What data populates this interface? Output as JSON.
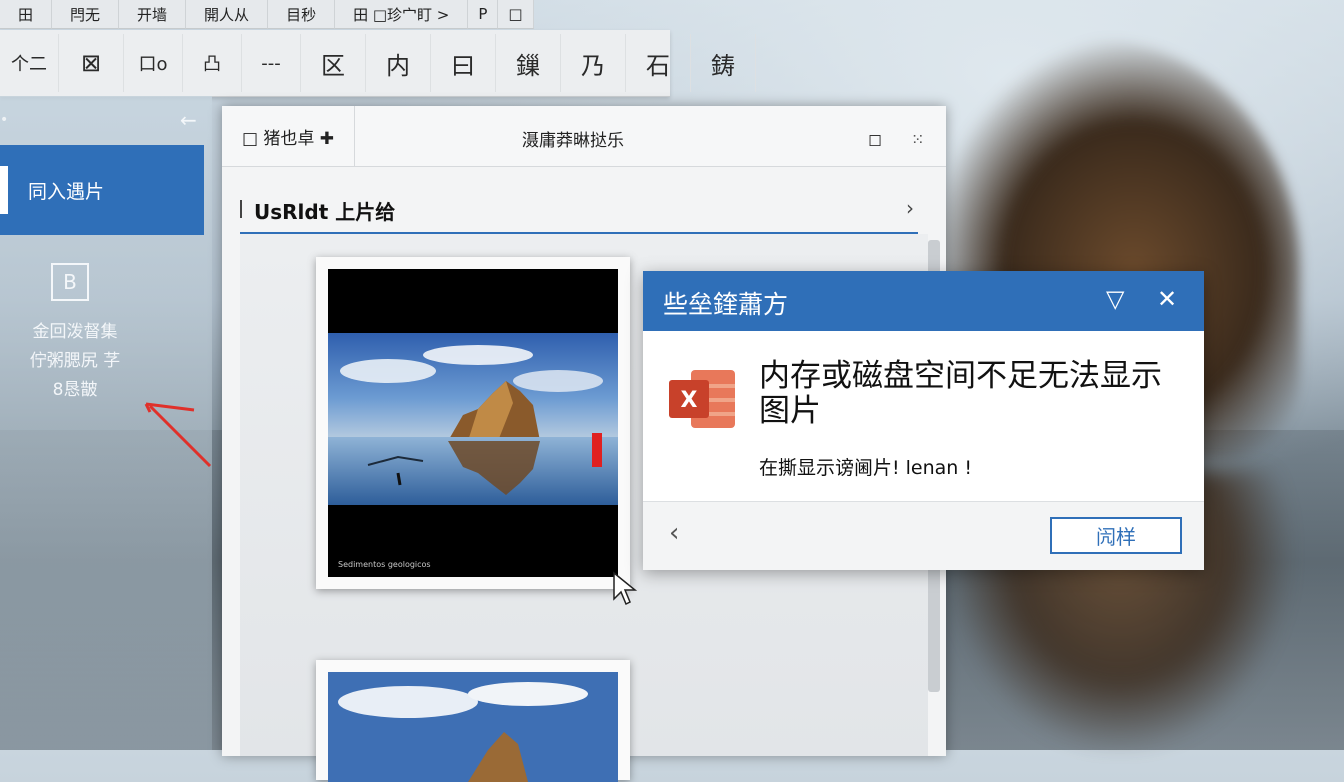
{
  "colors": {
    "accent": "#2f6fb8",
    "error_mark": "#e02020",
    "excel_icon": "#d4502a"
  },
  "tabs": [
    "田",
    "閂无",
    "开墙",
    "開人从",
    "目秒",
    "田 □珍宀盯 >",
    "P",
    "□"
  ],
  "ribbon": {
    "buttons": [
      {
        "label": "个二",
        "icon": "arrow-left-icon"
      },
      {
        "label": "⊠",
        "icon": "crop-icon"
      },
      {
        "label": "口o",
        "icon": "shape-icon"
      },
      {
        "label": "凸",
        "icon": "frame-icon"
      },
      {
        "label": "---",
        "icon": "dash-icon"
      },
      {
        "label": "区",
        "icon": "image-box-icon"
      },
      {
        "label": "内",
        "icon": "insert-icon"
      },
      {
        "label": "曰",
        "icon": "panel-icon"
      },
      {
        "label": "鏁",
        "icon": "format-icon"
      },
      {
        "label": "乃",
        "icon": "tool-icon"
      },
      {
        "label": "石",
        "icon": "stone-icon"
      },
      {
        "label": "鋳",
        "icon": "cast-icon"
      }
    ]
  },
  "sidebar": {
    "back_icon": "←",
    "active_item": "同入遇片",
    "icon_glyph": "B",
    "text_lines": [
      "金回泼督集",
      "佇粥腮尻   芓",
      "8恳皵"
    ]
  },
  "main_window": {
    "back_label": "□ 猪也卓 ✚",
    "title": "滠庸莽晽挞乐",
    "section_title": "UsRldt 上片给",
    "photo_caption": "Sedimentos geologicos"
  },
  "popup": {
    "title": "些垒鍷蕭方",
    "message": "内存或磁盘空间不足无法显示图片",
    "sub_message": "在撕显示谤阃片! lenan !",
    "button_label": "闶样",
    "icon": "excel-icon",
    "excel_letter": "X"
  }
}
